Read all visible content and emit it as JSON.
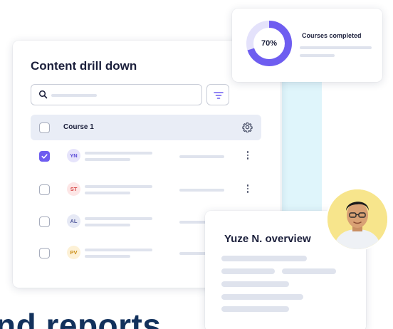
{
  "main_card": {
    "title": "Content drill down",
    "table_header": {
      "course_label": "Course 1"
    },
    "rows": [
      {
        "initials": "YN",
        "checked": true,
        "badge_bg": "#e6e4fb",
        "badge_fg": "#5b4bd8"
      },
      {
        "initials": "ST",
        "checked": false,
        "badge_bg": "#fde6e6",
        "badge_fg": "#d64545"
      },
      {
        "initials": "AL",
        "checked": false,
        "badge_bg": "#e6e9f5",
        "badge_fg": "#5860a0"
      },
      {
        "initials": "PV",
        "checked": false,
        "badge_bg": "#fdf1d6",
        "badge_fg": "#c98a12"
      }
    ]
  },
  "completed_card": {
    "percent_label": "70%",
    "percent": 70,
    "title": "Courses completed"
  },
  "overview_card": {
    "title": "Yuze N. overview"
  },
  "bottom_text": "nd reports",
  "colors": {
    "accent": "#6e5df0",
    "donut_track": "#e4e2fb",
    "cyan_strip": "#dff5fb",
    "heading_navy": "#12315c"
  }
}
